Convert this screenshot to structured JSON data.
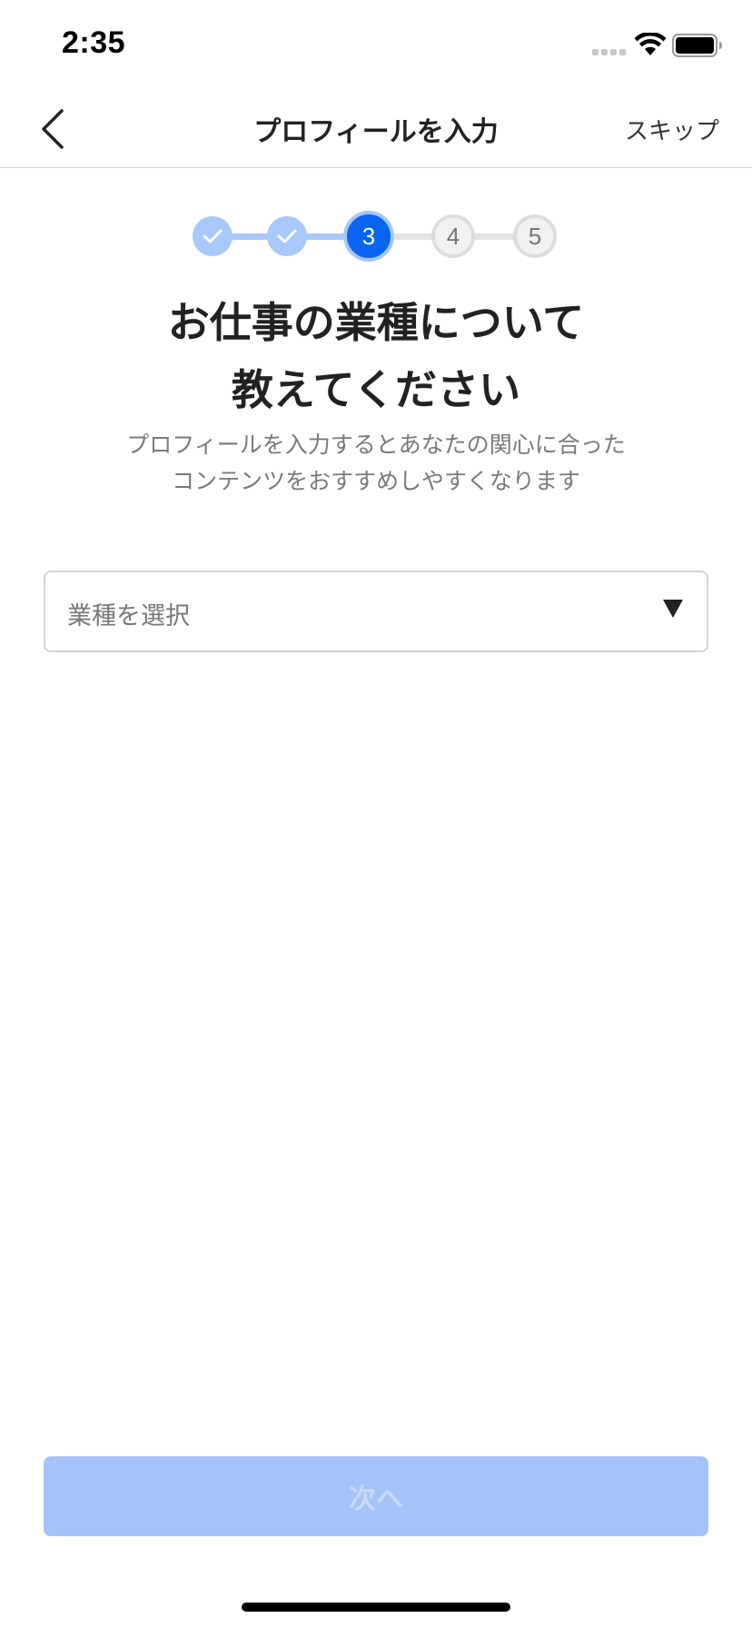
{
  "status_bar": {
    "time": "2:35",
    "icons": [
      "signal-icon",
      "wifi-icon",
      "battery-icon"
    ]
  },
  "nav": {
    "back_icon": "chevron-left-icon",
    "title": "プロフィールを入力",
    "skip_label": "スキップ"
  },
  "stepper": {
    "current_step": 3,
    "total_steps": 5,
    "steps": [
      {
        "state": "done",
        "icon": "check-icon"
      },
      {
        "state": "done",
        "icon": "check-icon"
      },
      {
        "state": "active",
        "label": "3"
      },
      {
        "state": "todo",
        "label": "4"
      },
      {
        "state": "todo",
        "label": "5"
      }
    ]
  },
  "content": {
    "heading_line1": "お仕事の業種について",
    "heading_line2": "教えてください",
    "subtext_line1": "プロフィールを入力するとあなたの関心に合った",
    "subtext_line2": "コンテンツをおすすめしやすくなります"
  },
  "industry_select": {
    "placeholder": "業種を選択",
    "arrow_icon": "dropdown-arrow-icon"
  },
  "next_button": {
    "label": "次へ",
    "enabled": false
  },
  "colors": {
    "accent": "#0a64f0",
    "accent_light": "#a6c8fa",
    "button_disabled_bg": "#a3c3f8",
    "button_disabled_text": "#c7dafb",
    "text_primary": "#222222",
    "text_secondary": "#7a7a7a"
  }
}
